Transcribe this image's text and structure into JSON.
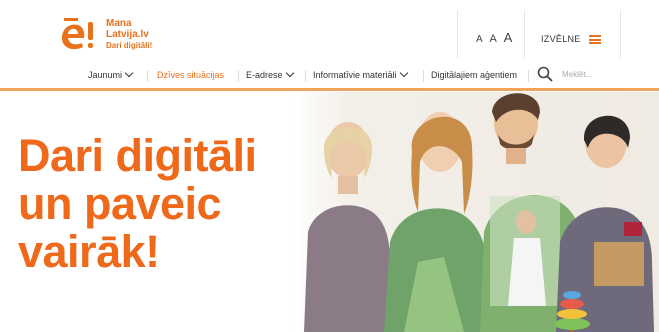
{
  "brand": {
    "line1": "Mana",
    "line2": "Latvija.lv",
    "line3": "Dari digitāli!",
    "accent": "#e8711c"
  },
  "header": {
    "font_size_labels": [
      "A",
      "A",
      "A"
    ],
    "menu_label": "IZVĒLNE"
  },
  "nav": {
    "items": [
      {
        "label": "Jaunumi",
        "has_dropdown": true,
        "active": false
      },
      {
        "label": "Dzīves situācijas",
        "has_dropdown": false,
        "active": true
      },
      {
        "label": "E-adrese",
        "has_dropdown": true,
        "active": false
      },
      {
        "label": "Informatīvie materiāli",
        "has_dropdown": true,
        "active": false
      },
      {
        "label": "Digitālajiem aģentiem",
        "has_dropdown": false,
        "active": false
      }
    ],
    "search_placeholder": "Meklēt..."
  },
  "hero": {
    "line1": "Dari digitāli",
    "line2": "un paveic",
    "line3": "vairāk!",
    "image_icon": "people-illustration"
  }
}
